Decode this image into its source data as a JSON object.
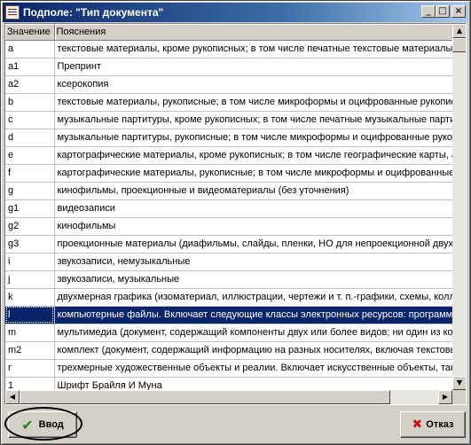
{
  "window": {
    "title": "Подполе: \"Тип документа\"",
    "minimize": "_",
    "maximize": "□",
    "close": "×"
  },
  "grid": {
    "columns": [
      "Значение",
      "Пояснения"
    ],
    "rows": [
      {
        "value": "a",
        "desc": "текстовые материалы, кроме рукописных; в том числе печатные текстовые материалы"
      },
      {
        "value": "a1",
        "desc": "Препринт"
      },
      {
        "value": "a2",
        "desc": "ксерокопия"
      },
      {
        "value": "b",
        "desc": "текстовые материалы, рукописные; в том числе микроформы и оцифрованные рукописи"
      },
      {
        "value": "c",
        "desc": "музыкальные партитуры, кроме рукописных; в том числе печатные музыкальные партитуры"
      },
      {
        "value": "d",
        "desc": "музыкальные партитуры, рукописные; в том числе микроформы и оцифрованные рукописи"
      },
      {
        "value": "e",
        "desc": "картографические материалы, кроме рукописных; в том числе географические карты, атласы"
      },
      {
        "value": "f",
        "desc": "картографические материалы, рукописные; в том числе микроформы и оцифрованные"
      },
      {
        "value": "g",
        "desc": "кинофильмы, проекционные и видеоматериалы (без уточнения)"
      },
      {
        "value": "g1",
        "desc": "видеозаписи"
      },
      {
        "value": "g2",
        "desc": "кинофильмы"
      },
      {
        "value": "g3",
        "desc": "проекционные материалы (диафильмы, слайды, пленки, НО для непроекционной двухмерной"
      },
      {
        "value": "i",
        "desc": "звукозаписи, немузыкальные"
      },
      {
        "value": "j",
        "desc": "звукозаписи, музыкальные"
      },
      {
        "value": "k",
        "desc": "двухмерная графика (изоматериал, иллюстрации, чертежи и т. п.-графики, схемы, коллажи"
      },
      {
        "value": "l",
        "desc": "компьютерные файлы. Включает следующие классы электронных ресурсов: программное"
      },
      {
        "value": "m",
        "desc": "мультимедиа (документ, содержащий компоненты двух или более видов; ни один из компонентов"
      },
      {
        "value": "m2",
        "desc": "комплект (документ, содержащий информацию на разных носителях, включая текстовые"
      },
      {
        "value": "r",
        "desc": "трехмерные художественные объекты и реалии. Включает искусственные объекты, такие"
      },
      {
        "value": "1",
        "desc": "Шрифт Брайля И Муна"
      }
    ],
    "selected_index": 15
  },
  "buttons": {
    "ok_label": "Ввод",
    "cancel_label": "Отказ"
  },
  "icons": {
    "ok": "check-icon",
    "cancel": "cross-icon"
  }
}
